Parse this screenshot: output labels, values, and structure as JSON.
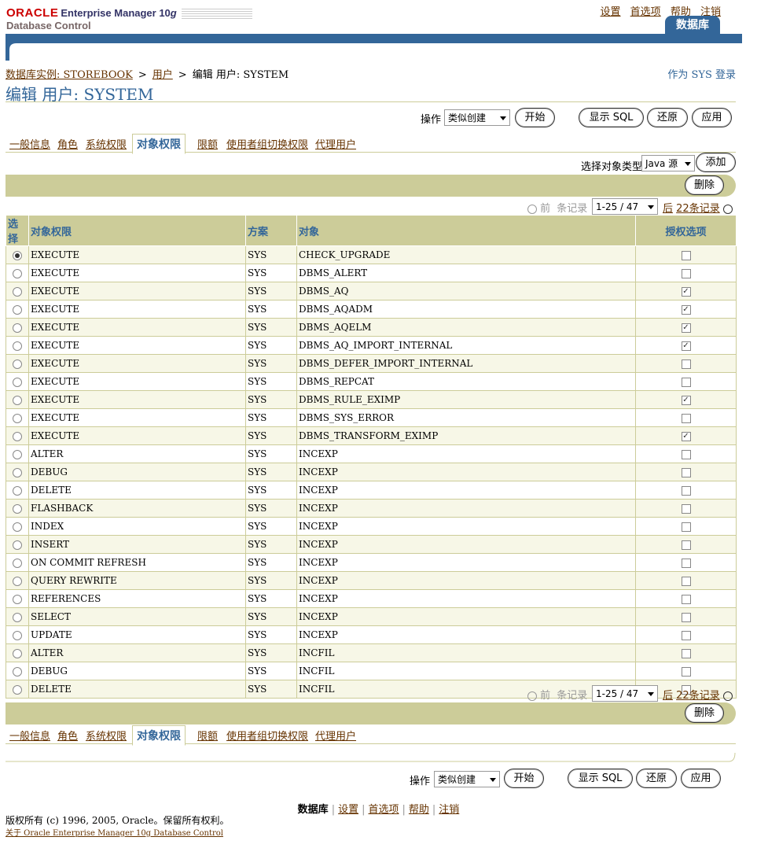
{
  "header": {
    "brand": "ORACLE",
    "product": "Enterprise Manager 10",
    "product_g": "g",
    "subtitle": "Database Control",
    "global_links": [
      "设置",
      "首选项",
      "帮助",
      "注销"
    ],
    "active_tab": "数据库"
  },
  "breadcrumb": {
    "items": [
      "数据库实例: STOREBOOK",
      "用户"
    ],
    "current": "编辑  用户: SYSTEM"
  },
  "login_as": "作为  SYS 登录",
  "page_title": "编辑  用户: SYSTEM",
  "actions": {
    "label": "操作",
    "selected": "类似创建",
    "go": "开始",
    "show_sql": "显示 SQL",
    "revert": "还原",
    "apply": "应用"
  },
  "subtabs": [
    "一般信息",
    "角色",
    "系统权限",
    "对象权限",
    "限额",
    "使用者组切换权限",
    "代理用户"
  ],
  "object_type": {
    "label": "选择对象类型",
    "selected": "Java 源",
    "add": "添加"
  },
  "delete_label": "删除",
  "navigation": {
    "prev": "前",
    "records": "条记录",
    "range": "1-25 / 47",
    "next": "后",
    "next_count": "22",
    "next_records": "条记录"
  },
  "table": {
    "columns": [
      "选择",
      "对象权限",
      "方案",
      "对象",
      "授权选项"
    ],
    "rows": [
      {
        "priv": "EXECUTE",
        "schema": "SYS",
        "object": "CHECK_UPGRADE",
        "grant": false,
        "selected": true
      },
      {
        "priv": "EXECUTE",
        "schema": "SYS",
        "object": "DBMS_ALERT",
        "grant": false
      },
      {
        "priv": "EXECUTE",
        "schema": "SYS",
        "object": "DBMS_AQ",
        "grant": true
      },
      {
        "priv": "EXECUTE",
        "schema": "SYS",
        "object": "DBMS_AQADM",
        "grant": true
      },
      {
        "priv": "EXECUTE",
        "schema": "SYS",
        "object": "DBMS_AQELM",
        "grant": true
      },
      {
        "priv": "EXECUTE",
        "schema": "SYS",
        "object": "DBMS_AQ_IMPORT_INTERNAL",
        "grant": true
      },
      {
        "priv": "EXECUTE",
        "schema": "SYS",
        "object": "DBMS_DEFER_IMPORT_INTERNAL",
        "grant": false
      },
      {
        "priv": "EXECUTE",
        "schema": "SYS",
        "object": "DBMS_REPCAT",
        "grant": false
      },
      {
        "priv": "EXECUTE",
        "schema": "SYS",
        "object": "DBMS_RULE_EXIMP",
        "grant": true
      },
      {
        "priv": "EXECUTE",
        "schema": "SYS",
        "object": "DBMS_SYS_ERROR",
        "grant": false
      },
      {
        "priv": "EXECUTE",
        "schema": "SYS",
        "object": "DBMS_TRANSFORM_EXIMP",
        "grant": true
      },
      {
        "priv": "ALTER",
        "schema": "SYS",
        "object": "INCEXP",
        "grant": false
      },
      {
        "priv": "DEBUG",
        "schema": "SYS",
        "object": "INCEXP",
        "grant": false
      },
      {
        "priv": "DELETE",
        "schema": "SYS",
        "object": "INCEXP",
        "grant": false
      },
      {
        "priv": "FLASHBACK",
        "schema": "SYS",
        "object": "INCEXP",
        "grant": false
      },
      {
        "priv": "INDEX",
        "schema": "SYS",
        "object": "INCEXP",
        "grant": false
      },
      {
        "priv": "INSERT",
        "schema": "SYS",
        "object": "INCEXP",
        "grant": false
      },
      {
        "priv": "ON COMMIT REFRESH",
        "schema": "SYS",
        "object": "INCEXP",
        "grant": false
      },
      {
        "priv": "QUERY REWRITE",
        "schema": "SYS",
        "object": "INCEXP",
        "grant": false
      },
      {
        "priv": "REFERENCES",
        "schema": "SYS",
        "object": "INCEXP",
        "grant": false
      },
      {
        "priv": "SELECT",
        "schema": "SYS",
        "object": "INCEXP",
        "grant": false
      },
      {
        "priv": "UPDATE",
        "schema": "SYS",
        "object": "INCEXP",
        "grant": false
      },
      {
        "priv": "ALTER",
        "schema": "SYS",
        "object": "INCFIL",
        "grant": false
      },
      {
        "priv": "DEBUG",
        "schema": "SYS",
        "object": "INCFIL",
        "grant": false
      },
      {
        "priv": "DELETE",
        "schema": "SYS",
        "object": "INCFIL",
        "grant": false
      }
    ]
  },
  "footer": {
    "links": [
      "数据库",
      "设置",
      "首选项",
      "帮助",
      "注销"
    ],
    "copyright": "版权所有  (c) 1996, 2005, Oracle。保留所有权利。",
    "about": "关于  Oracle Enterprise Manager 10g Database Control"
  },
  "colors": {
    "accent": "#336699",
    "olive": "#cccc99",
    "link": "#663300"
  }
}
